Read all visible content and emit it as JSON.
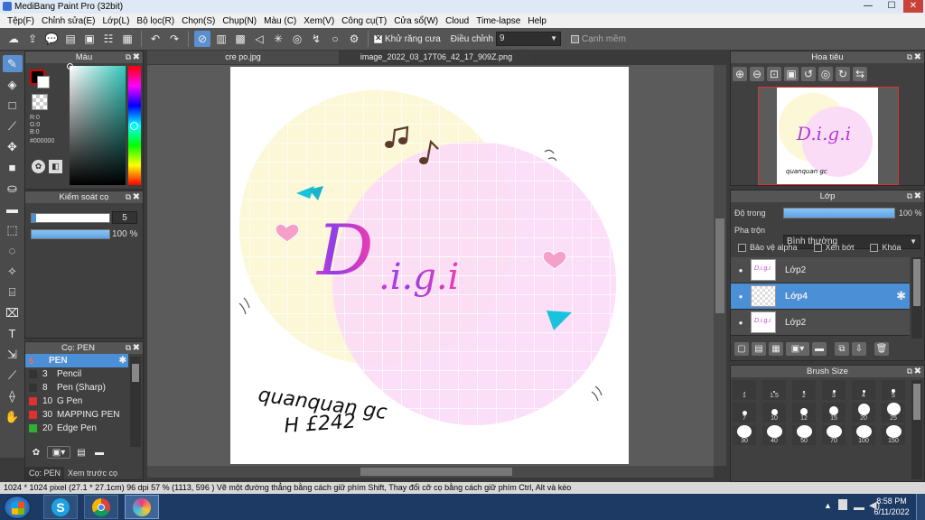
{
  "window": {
    "title": "MediBang Paint Pro (32bit)",
    "min_btn": "—",
    "max_btn": "☐",
    "close_btn": "✕"
  },
  "menu": [
    "Tệp(F)",
    "Chỉnh sửa(E)",
    "Lớp(L)",
    "Bộ lọc(R)",
    "Chọn(S)",
    "Chụp(N)",
    "Màu (C)",
    "Xem(V)",
    "Công cụ(T)",
    "Cửa sổ(W)",
    "Cloud",
    "Time-lapse",
    "Help"
  ],
  "toolbar": {
    "antialias_label": "Khử răng cưa",
    "correction_label": "Điều chỉnh",
    "correction_value": "9",
    "edge_label": "Cạnh mềm"
  },
  "tabs": {
    "tab1": "cre po.jpg",
    "tab2": "image_2022_03_17T06_42_17_909Z.png"
  },
  "color_panel": {
    "title": "Màu",
    "r": "R:0",
    "g": "G:0",
    "b": "B:0",
    "hex": "#000000",
    "fg_color": "#000000",
    "bg_color": "#ffffff"
  },
  "brush_control": {
    "title": "Kiểm soát cọ",
    "size_value": "5",
    "opacity_value": "100 %"
  },
  "brush_panel": {
    "title": "Cọ: PEN",
    "items": [
      {
        "num": "5",
        "name": "PEN",
        "color": "#4b8fd6"
      },
      {
        "num": "3",
        "name": "Pencil",
        "color": "#333333"
      },
      {
        "num": "8",
        "name": "Pen (Sharp)",
        "color": "#333333"
      },
      {
        "num": "10",
        "name": "G Pen",
        "color": "#e03030"
      },
      {
        "num": "30",
        "name": "MAPPING PEN",
        "color": "#e03030"
      },
      {
        "num": "20",
        "name": "Edge Pen",
        "color": "#30b030"
      }
    ],
    "bottom_tab1": "Cọ: PEN",
    "bottom_tab2": "Xem trước cọ"
  },
  "navigator": {
    "title": "Hoa tiêu"
  },
  "layer_panel": {
    "title": "Lớp",
    "opacity_label": "Độ trong",
    "opacity_value": "100 %",
    "blend_label": "Pha trộn",
    "blend_value": "Bình thường",
    "protect_alpha": "Bảo vệ alpha",
    "clipping": "Xén bớt",
    "lock": "Khóa",
    "layers": [
      {
        "name": "Lớp2",
        "selected": false
      },
      {
        "name": "Lớp4",
        "selected": true
      },
      {
        "name": "Lớp2",
        "selected": false
      }
    ]
  },
  "brush_size": {
    "title": "Brush Size",
    "sizes": [
      "1",
      "1.5",
      "2",
      "3",
      "4",
      "5",
      "7",
      "10",
      "12",
      "15",
      "20",
      "25",
      "30",
      "40",
      "50",
      "70",
      "100",
      "150"
    ]
  },
  "canvas_text": {
    "handwriting1": "quanquan gc",
    "handwriting2": "H £242"
  },
  "status": "1024 * 1024 pixel   (27.1 * 27.1cm)   96 dpi   57 %   (1113, 596 )   Vẽ một đường thẳng bằng cách giữ phím Shift, Thay đổi cỡ cọ bằng cách giữ phím Ctrl, Alt và kéo",
  "taskbar": {
    "time": "8:58 PM",
    "date": "6/11/2022"
  }
}
